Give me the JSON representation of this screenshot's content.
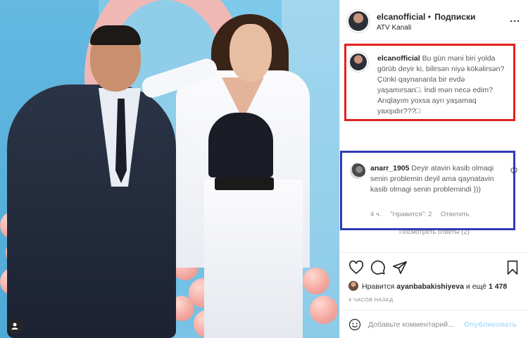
{
  "post": {
    "account": "elcanofficial",
    "follow_separator": "•",
    "follow_label": "Подписки",
    "subtitle": "ATV Kanali",
    "more_label": "..."
  },
  "caption": {
    "username": "elcanofficial",
    "text": "Bu gün məni biri yolda görüb deyir ki, bilirsən niyə kökəlirsən? Çünki qaynananla bir evdə yaşamırsan□. İndi mən necə edim? Arıqlayım yoxsa ayrı yaşamaq yaxşıdır???□"
  },
  "comment": {
    "username": "anarr_1905",
    "text": "Deyir atavin kasib olmaqi senin problemin deyil ama qaynatavin kasib olmagi senin problemindi )))",
    "time": "4 ч.",
    "likes": "\"Нравится\": 2",
    "reply_label": "Ответить"
  },
  "view_replies": "Посмотреть ответы (2)",
  "likes": {
    "prefix": "Нравится",
    "user": "ayanbabakishiyeva",
    "suffix": "и ещё",
    "count": "1 478"
  },
  "posted_time": "4 ЧАСОВ НАЗАД",
  "add_comment": {
    "placeholder": "Добавьте комментарий...",
    "publish_label": "Опубликовать"
  },
  "colors": {
    "highlight_caption": "#e1231f",
    "highlight_comment": "#2f3bb8",
    "publish_disabled": "#b2dffc"
  }
}
